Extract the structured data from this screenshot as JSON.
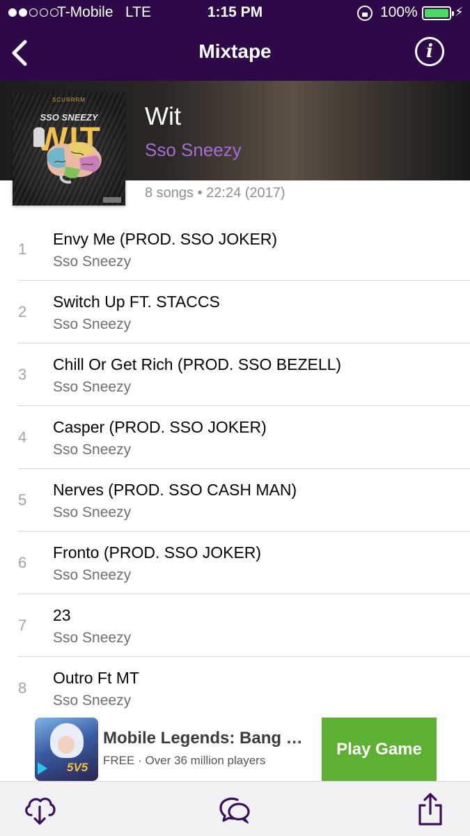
{
  "status_bar": {
    "carrier": "T-Mobile",
    "network": "LTE",
    "time": "1:15 PM",
    "battery": "100%",
    "signal_bars_filled": 2,
    "signal_bars_total": 5
  },
  "nav": {
    "title": "Mixtape",
    "back_icon": "chevron-left-icon",
    "info_icon": "info-icon",
    "info_glyph": "i"
  },
  "album": {
    "title": "Wit",
    "artist": "Sso Sneezy",
    "meta": "8 songs • 22:24 (2017)",
    "cover": {
      "label": "SCURRRM",
      "artist": "SSO SNEEZY",
      "title": "WIT"
    }
  },
  "tracks": [
    {
      "number": "1",
      "title": "Envy Me (PROD. SSO JOKER)",
      "artist": "Sso Sneezy"
    },
    {
      "number": "2",
      "title": "Switch Up FT. STACCS",
      "artist": "Sso Sneezy"
    },
    {
      "number": "3",
      "title": "Chill Or Get Rich (PROD. SSO BEZELL)",
      "artist": "Sso Sneezy"
    },
    {
      "number": "4",
      "title": "Casper (PROD. SSO JOKER)",
      "artist": "Sso Sneezy"
    },
    {
      "number": "5",
      "title": "Nerves (PROD. SSO CASH MAN)",
      "artist": "Sso Sneezy"
    },
    {
      "number": "6",
      "title": "Fronto (PROD. SSO JOKER)",
      "artist": "Sso Sneezy"
    },
    {
      "number": "7",
      "title": "23",
      "artist": "Sso Sneezy"
    },
    {
      "number": "8",
      "title": "Outro Ft MT",
      "artist": "Sso Sneezy"
    }
  ],
  "ad": {
    "title": "Mobile Legends: Bang …",
    "subtitle": "FREE · Over 36 million players",
    "cta": "Play Game",
    "icon_badge": "5V5"
  },
  "toolbar": {
    "download_icon": "cloud-download-icon",
    "comments_icon": "chat-bubbles-icon",
    "share_icon": "share-icon"
  },
  "colors": {
    "nav_background": "#2d0a47",
    "artist_accent": "#a46ed6",
    "cta_green": "#5db032",
    "battery_green": "#4cd964"
  }
}
